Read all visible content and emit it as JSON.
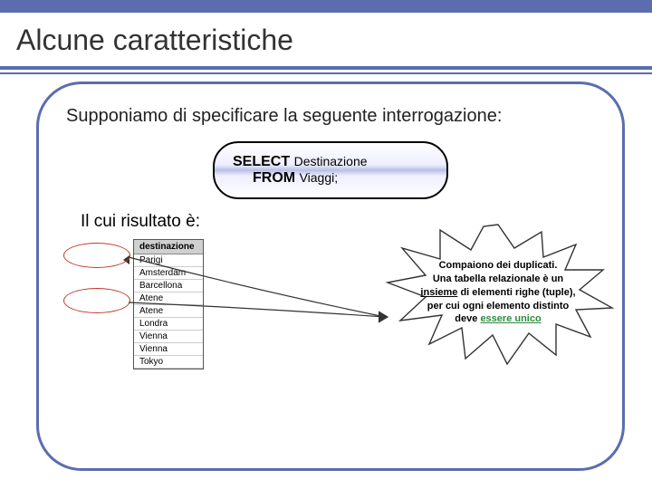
{
  "title": "Alcune caratteristiche",
  "subtitle": "Supponiamo di specificare la seguente interrogazione:",
  "sql": {
    "kw1": "SELECT",
    "arg1": "Destinazione",
    "kw2": "FROM",
    "arg2": "Viaggi;"
  },
  "result_label": "Il cui risultato è:",
  "table": {
    "header": "destinazione",
    "rows": [
      "Parigi",
      "Amsterdam",
      "Barcellona",
      "Atene",
      "Atene",
      "Londra",
      "Vienna",
      "Vienna",
      "Tokyo"
    ]
  },
  "callout": {
    "l1": "Compaiono dei duplicati.",
    "l2a": "Una tabella relazionale è un",
    "l2u": "insieme",
    "l2b": " di elementi righe (tuple),",
    "l3": "per cui ogni elemento distinto",
    "l4a": "deve ",
    "l4g": "essere unico"
  }
}
